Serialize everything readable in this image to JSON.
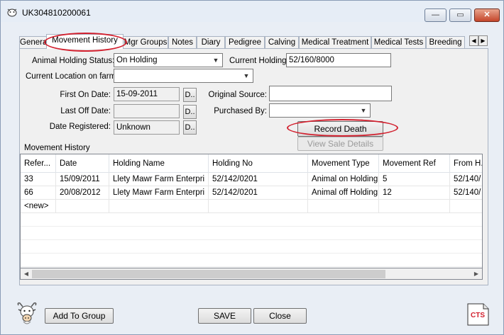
{
  "window": {
    "title": "UK304810200061",
    "minimize_label": "—",
    "maximize_label": "▭",
    "close_label": "✕",
    "icons": [
      "app-icon",
      "minimize-icon",
      "maximize-icon",
      "close-icon"
    ]
  },
  "tabs": [
    "General",
    "Movement History",
    "Mgr Groups",
    "Notes",
    "Diary",
    "Pedigree",
    "Calving",
    "Medical Treatment",
    "Medical Tests",
    "Breeding"
  ],
  "active_tab": "Movement History",
  "tab_scroll": {
    "left": "◀",
    "right": "▶"
  },
  "form": {
    "holding_status_label": "Animal Holding Status:",
    "holding_status_value": "On Holding",
    "current_holding_label": "Current Holding:",
    "current_holding_value": "52/160/8000",
    "current_location_label": "Current Location on farm:",
    "current_location_value": "",
    "first_on_label": "First On Date:",
    "first_on_value": "15-09-2011",
    "last_off_label": "Last Off Date:",
    "last_off_value": "",
    "date_registered_label": "Date Registered:",
    "date_registered_value": "Unknown",
    "date_button_label": "D..",
    "original_source_label": "Original Source:",
    "original_source_value": "",
    "purchased_by_label": "Purchased By:",
    "purchased_by_value": "",
    "record_death_label": "Record Death",
    "view_sale_label": "View Sale Details"
  },
  "movement_history": {
    "title": "Movement History",
    "columns": [
      "Refer...",
      "Date",
      "Holding Name",
      "Holding No",
      "Movement Type",
      "Movement Ref",
      "From H.N"
    ],
    "rows": [
      [
        "33",
        "15/09/2011",
        "Llety Mawr Farm Enterpri",
        "52/142/0201",
        "Animal on Holding",
        "5",
        "52/140/"
      ],
      [
        "66",
        "20/08/2012",
        "Llety Mawr Farm Enterpri",
        "52/142/0201",
        "Animal off Holding",
        "12",
        "52/140/"
      ]
    ],
    "new_row": "<new>",
    "scroll_left": "◀",
    "scroll_right": "▶"
  },
  "footer": {
    "add_to_group_label": "Add To Group",
    "save_label": "SAVE",
    "close_label": "Close",
    "cts_logo_text": "CTS"
  },
  "colors": {
    "annotation_red": "#d2202e",
    "window_bg": "#e9eef5",
    "cts_red": "#d2202e"
  }
}
